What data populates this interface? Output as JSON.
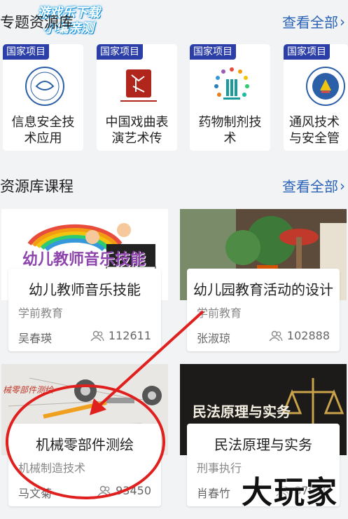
{
  "watermark": {
    "line1": "游戏乐下载",
    "line2": "小编亲测"
  },
  "projects_section": {
    "title": "专题资源库",
    "view_all": "查看全部",
    "items": [
      {
        "tag": "国家项目",
        "name": "信息安全技术应用（信…"
      },
      {
        "tag": "国家项目",
        "name": "中国戏曲表演艺术传承…"
      },
      {
        "tag": "国家项目",
        "name": "药物制剂技术"
      },
      {
        "tag": "国家项目",
        "name": "通风技术与安全管理"
      }
    ]
  },
  "courses_section": {
    "title": "资源库课程",
    "view_all": "查看全部",
    "items": [
      {
        "thumb_text": "幼儿教师音乐技能",
        "title": "幼儿教师音乐技能",
        "category": "学前教育",
        "teacher": "吴春瑛",
        "views": "112611"
      },
      {
        "thumb_text": "",
        "title": "幼儿园教育活动的设计",
        "category": "学前教育",
        "teacher": "张淑琼",
        "views": "102888"
      },
      {
        "thumb_text": "械零部件测绘",
        "title": "机械零部件测绘",
        "category": "机械制造技术",
        "teacher": "马文菊",
        "views": "93450"
      },
      {
        "thumb_text": "民法原理与实务",
        "title": "民法原理与实务",
        "category": "刑事执行",
        "teacher": "肖春竹",
        "views": "87950"
      }
    ]
  },
  "brand_watermark": "大玩家",
  "colors": {
    "accent": "#2a63b8",
    "tag": "#2c3fa8",
    "annotation": "#e0201e"
  }
}
